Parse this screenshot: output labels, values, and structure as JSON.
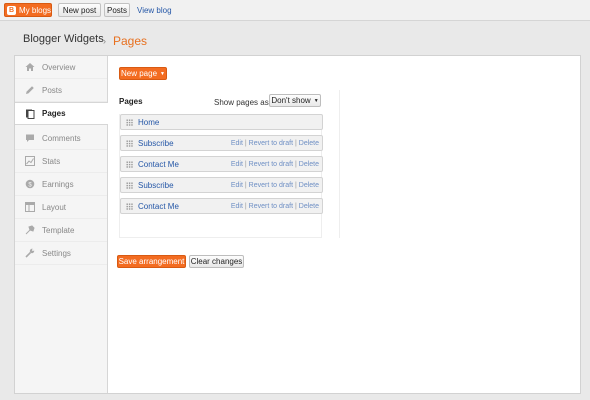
{
  "topbar": {
    "my_blogs": "My blogs",
    "new_post": "New post",
    "posts": "Posts",
    "view_blog": "View blog"
  },
  "header": {
    "blog_title": "Blogger Widgets",
    "separator": "›",
    "page_title": "Pages"
  },
  "sidebar": {
    "items": [
      {
        "label": "Overview",
        "icon": "home-icon",
        "active": false
      },
      {
        "label": "Posts",
        "icon": "pencil-icon",
        "active": false
      },
      {
        "label": "Pages",
        "icon": "pages-icon",
        "active": true
      },
      {
        "label": "Comments",
        "icon": "comment-icon",
        "active": false
      },
      {
        "label": "Stats",
        "icon": "stats-icon",
        "active": false
      },
      {
        "label": "Earnings",
        "icon": "earnings-icon",
        "active": false
      },
      {
        "label": "Layout",
        "icon": "layout-icon",
        "active": false
      },
      {
        "label": "Template",
        "icon": "template-icon",
        "active": false
      },
      {
        "label": "Settings",
        "icon": "wrench-icon",
        "active": false
      }
    ]
  },
  "main": {
    "new_page_label": "New page",
    "pages_heading": "Pages",
    "show_pages_as": "Show pages as",
    "show_pages_value": "Don't show",
    "rows": [
      {
        "title": "Home",
        "edit": "",
        "revert": "",
        "delete": ""
      },
      {
        "title": "Subscribe",
        "edit": "Edit",
        "revert": "Revert to draft",
        "delete": "Delete"
      },
      {
        "title": "Contact Me",
        "edit": "Edit",
        "revert": "Revert to draft",
        "delete": "Delete"
      },
      {
        "title": "Subscribe",
        "edit": "Edit",
        "revert": "Revert to draft",
        "delete": "Delete"
      },
      {
        "title": "Contact Me",
        "edit": "Edit",
        "revert": "Revert to draft",
        "delete": "Delete"
      }
    ],
    "save_label": "Save arrangement",
    "clear_label": "Clear changes"
  },
  "colors": {
    "accent": "#f36c21",
    "link": "#2557a7",
    "action_link": "#6e8fc4"
  }
}
